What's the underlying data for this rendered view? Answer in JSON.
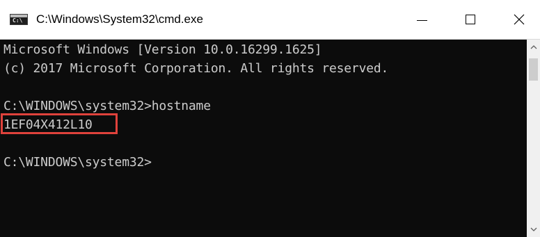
{
  "window": {
    "title": "C:\\Windows\\System32\\cmd.exe",
    "app_icon": "cmd-icon",
    "controls": {
      "minimize_icon": "minimize-icon",
      "maximize_icon": "maximize-icon",
      "close_icon": "close-icon"
    }
  },
  "console": {
    "lines": [
      "Microsoft Windows [Version 10.0.16299.1625]",
      "(c) 2017 Microsoft Corporation. All rights reserved.",
      "",
      "C:\\WINDOWS\\system32>hostname",
      "1EF04X412L10",
      "",
      "C:\\WINDOWS\\system32>"
    ],
    "highlighted_line_index": 4,
    "highlight_color": "#e0423c",
    "background_color": "#0c0c0c",
    "text_color": "#cccccc"
  },
  "scrollbar": {
    "up_icon": "scroll-up-arrow-icon",
    "down_icon": "scroll-down-arrow-icon"
  }
}
